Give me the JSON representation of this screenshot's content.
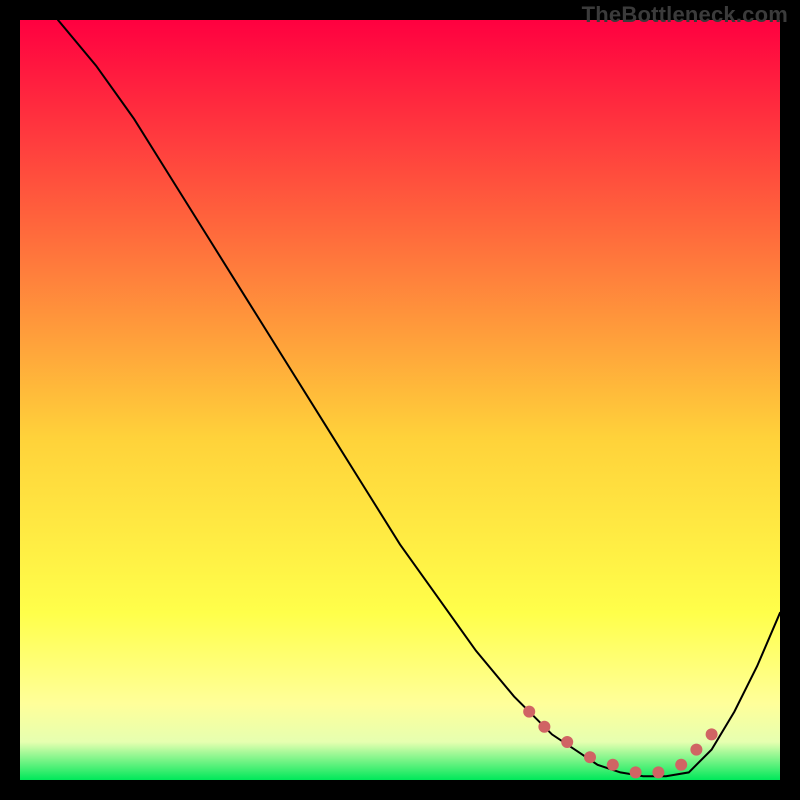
{
  "watermark": "TheBottleneck.com",
  "colors": {
    "curve": "#000000",
    "marker": "#d06464",
    "gradient_stops": [
      {
        "offset": "0%",
        "color": "#ff0040"
      },
      {
        "offset": "28%",
        "color": "#ff6a3c"
      },
      {
        "offset": "55%",
        "color": "#ffd23a"
      },
      {
        "offset": "78%",
        "color": "#ffff4a"
      },
      {
        "offset": "90%",
        "color": "#ffff9a"
      },
      {
        "offset": "95%",
        "color": "#e6ffb0"
      },
      {
        "offset": "100%",
        "color": "#00e85a"
      }
    ]
  },
  "chart_data": {
    "type": "line",
    "title": "",
    "xlabel": "",
    "ylabel": "",
    "xlim": [
      0,
      100
    ],
    "ylim": [
      0,
      100
    ],
    "series": [
      {
        "name": "bottleneck-curve",
        "x": [
          5,
          10,
          15,
          20,
          25,
          30,
          35,
          40,
          45,
          50,
          55,
          60,
          65,
          70,
          73,
          76,
          79,
          82,
          85,
          88,
          91,
          94,
          97,
          100
        ],
        "y": [
          100,
          94,
          87,
          79,
          71,
          63,
          55,
          47,
          39,
          31,
          24,
          17,
          11,
          6,
          4,
          2,
          1,
          0.5,
          0.5,
          1,
          4,
          9,
          15,
          22
        ]
      }
    ],
    "highlight_points": {
      "name": "optimal-range-markers",
      "x": [
        67,
        69,
        72,
        75,
        78,
        81,
        84,
        87,
        89,
        91
      ],
      "y": [
        9,
        7,
        5,
        3,
        2,
        1,
        1,
        2,
        4,
        6
      ]
    }
  }
}
